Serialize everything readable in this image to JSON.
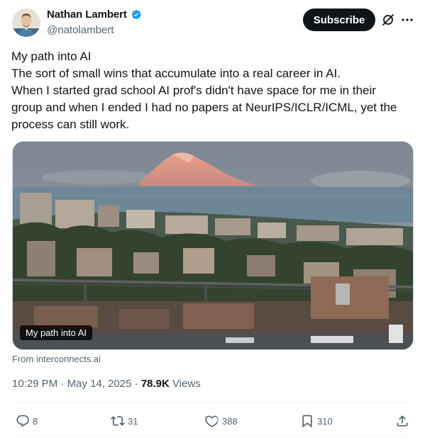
{
  "author": {
    "name": "Nathan Lambert",
    "handle": "@natolambert",
    "verified": true
  },
  "header_actions": {
    "subscribe_label": "Subscribe",
    "grok_icon": "grok-icon",
    "more_icon": "more-icon"
  },
  "tweet": {
    "lines": [
      "My path into AI",
      "The sort of small wins that accumulate into a real career in AI.",
      "When I started grad school AI prof's didn't have space for me in their",
      "group and when I ended I had no papers at NeurIPS/ICLR/ICML, yet the",
      "process can still work."
    ]
  },
  "card": {
    "title": "My path into AI",
    "source": "From interconnects.ai"
  },
  "meta": {
    "time": "10:29 PM",
    "date": "May 14, 2025",
    "separator": "·",
    "views_count": "78.9K",
    "views_label": "Views"
  },
  "actions": {
    "replies": "8",
    "reposts": "31",
    "likes": "388",
    "bookmarks": "310"
  },
  "colors": {
    "text": "#0f1419",
    "secondary": "#536471",
    "verified": "#1d9bf0",
    "subscribe_bg": "#0f1419"
  }
}
